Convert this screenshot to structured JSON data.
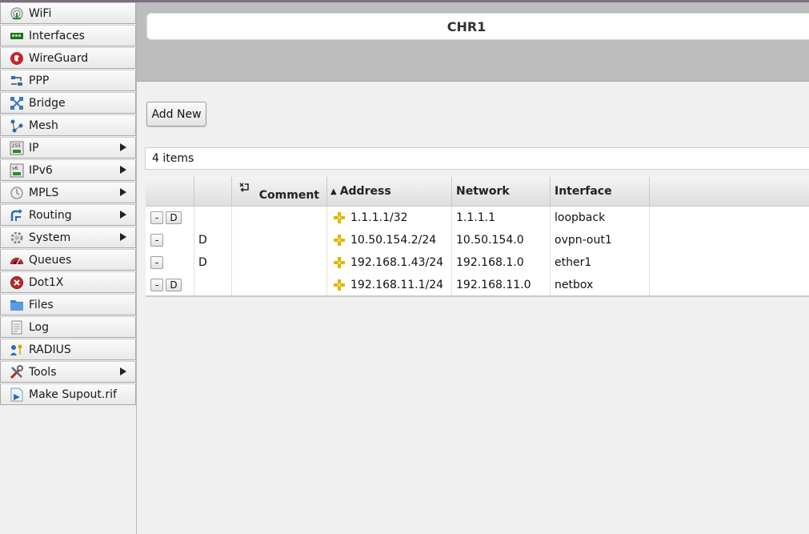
{
  "window": {
    "title": "CHR1"
  },
  "sidebar": {
    "items": [
      {
        "label": "WiFi",
        "icon": "wifi-icon",
        "submenu": false
      },
      {
        "label": "Interfaces",
        "icon": "interfaces-icon",
        "submenu": false
      },
      {
        "label": "WireGuard",
        "icon": "wireguard-icon",
        "submenu": false
      },
      {
        "label": "PPP",
        "icon": "ppp-icon",
        "submenu": false
      },
      {
        "label": "Bridge",
        "icon": "bridge-icon",
        "submenu": false
      },
      {
        "label": "Mesh",
        "icon": "mesh-icon",
        "submenu": false
      },
      {
        "label": "IP",
        "icon": "ip-icon",
        "submenu": true
      },
      {
        "label": "IPv6",
        "icon": "ipv6-icon",
        "submenu": true
      },
      {
        "label": "MPLS",
        "icon": "mpls-icon",
        "submenu": true
      },
      {
        "label": "Routing",
        "icon": "routing-icon",
        "submenu": true
      },
      {
        "label": "System",
        "icon": "gear-icon",
        "submenu": true
      },
      {
        "label": "Queues",
        "icon": "queues-icon",
        "submenu": false
      },
      {
        "label": "Dot1X",
        "icon": "dot1x-icon",
        "submenu": false
      },
      {
        "label": "Files",
        "icon": "folder-icon",
        "submenu": false
      },
      {
        "label": "Log",
        "icon": "log-icon",
        "submenu": false
      },
      {
        "label": "RADIUS",
        "icon": "radius-icon",
        "submenu": false
      },
      {
        "label": "Tools",
        "icon": "tools-icon",
        "submenu": true
      },
      {
        "label": "Make Supout.rif",
        "icon": "supout-icon",
        "submenu": false
      }
    ]
  },
  "toolbar": {
    "add_new_label": "Add New"
  },
  "list": {
    "count_label": "4 items"
  },
  "table": {
    "columns": {
      "actions": "",
      "flags": "",
      "comment": "Comment",
      "address": "Address",
      "network": "Network",
      "interface": "Interface"
    },
    "sort_indicator": "▲",
    "rows": [
      {
        "remove": "-",
        "disable": "D",
        "flag": "",
        "comment": "",
        "address": "1.1.1.1/32",
        "network": "1.1.1.1",
        "interface": "loopback"
      },
      {
        "remove": "-",
        "disable": "",
        "flag": "D",
        "comment": "",
        "address": "10.50.154.2/24",
        "network": "10.50.154.0",
        "interface": "ovpn-out1"
      },
      {
        "remove": "-",
        "disable": "",
        "flag": "D",
        "comment": "",
        "address": "192.168.1.43/24",
        "network": "192.168.1.0",
        "interface": "ether1"
      },
      {
        "remove": "-",
        "disable": "D",
        "flag": "",
        "comment": "",
        "address": "192.168.11.1/24",
        "network": "192.168.11.0",
        "interface": "netbox"
      }
    ]
  },
  "colors": {
    "header_band": "#bdbdbd",
    "address_icon": "#e8c400",
    "background": "#f0f0f0"
  }
}
